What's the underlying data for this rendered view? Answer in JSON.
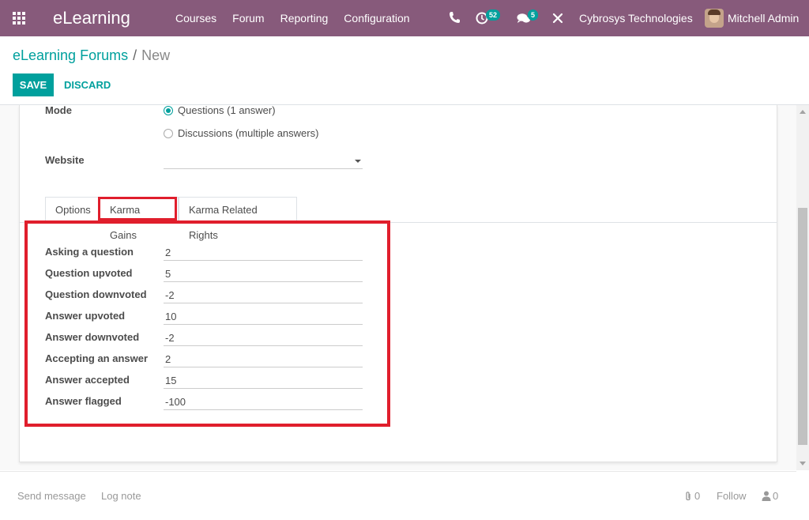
{
  "navbar": {
    "brand": "eLearning",
    "menu": [
      "Courses",
      "Forum",
      "Reporting",
      "Configuration"
    ],
    "activity_count": "52",
    "message_count": "5",
    "company": "Cybrosys Technologies",
    "user": "Mitchell Admin",
    "colors": {
      "bar": "#875a7b",
      "badge": "#01a09d"
    }
  },
  "breadcrumb": {
    "parent": "eLearning Forums",
    "separator": "/",
    "current": "New"
  },
  "toolbar": {
    "save_label": "SAVE",
    "discard_label": "DISCARD"
  },
  "form": {
    "mode_label": "Mode",
    "mode_options": [
      {
        "label": "Questions (1 answer)",
        "selected": true
      },
      {
        "label": "Discussions (multiple answers)",
        "selected": false
      }
    ],
    "website_label": "Website",
    "website_value": ""
  },
  "tabs": [
    {
      "label": "Options",
      "active": false
    },
    {
      "label": "Karma Gains",
      "active": true
    },
    {
      "label": "Karma Related Rights",
      "active": false
    }
  ],
  "karma_gains": [
    {
      "label": "Asking a question",
      "value": "2"
    },
    {
      "label": "Question upvoted",
      "value": "5"
    },
    {
      "label": "Question downvoted",
      "value": "-2"
    },
    {
      "label": "Answer upvoted",
      "value": "10"
    },
    {
      "label": "Answer downvoted",
      "value": "-2"
    },
    {
      "label": "Accepting an answer",
      "value": "2"
    },
    {
      "label": "Answer accepted",
      "value": "15"
    },
    {
      "label": "Answer flagged",
      "value": "-100"
    }
  ],
  "chatter": {
    "send_message": "Send message",
    "log_note": "Log note",
    "attachments": "0",
    "follow": "Follow",
    "followers": "0"
  },
  "highlight_color": "#e01e2c"
}
